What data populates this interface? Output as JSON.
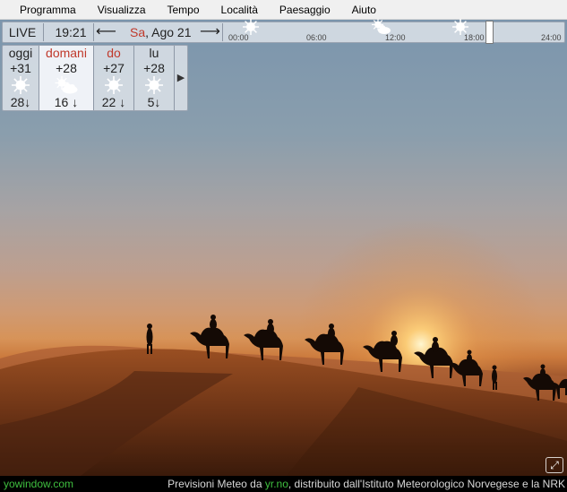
{
  "menu": [
    "Programma",
    "Visualizza",
    "Tempo",
    "Località",
    "Paesaggio",
    "Aiuto"
  ],
  "controls": {
    "live": "LIVE",
    "time": "19:21",
    "day_of_week": "Sa",
    "date": ", Ago 21",
    "prev_icon": "arrow-left-icon",
    "next_icon": "arrow-right-icon"
  },
  "timeline": {
    "labels": [
      "00:00",
      "06:00",
      "12:00",
      "18:00",
      "24:00"
    ],
    "icons": [
      "sun-icon",
      "partly-cloudy-icon",
      "sun-icon"
    ],
    "slider_position": 0.8
  },
  "forecast": [
    {
      "name": "oggi",
      "temp": "+31",
      "icon": "sun-icon",
      "wind": "28",
      "name_color": "#222222",
      "selected": false
    },
    {
      "name": "domani",
      "temp": "+28",
      "icon": "partly-cloudy-icon",
      "wind": "16",
      "name_color": "#c0392b",
      "selected": true
    },
    {
      "name": "do",
      "temp": "+27",
      "icon": "sun-icon",
      "wind": "22",
      "name_color": "#c0392b",
      "selected": false
    },
    {
      "name": "lu",
      "temp": "+28",
      "icon": "sun-icon",
      "wind": "5",
      "name_color": "#222222",
      "selected": false
    }
  ],
  "wind_arrow": "↓",
  "forecast_next": "▶",
  "footer": {
    "left": "yowindow.com",
    "right_prefix": "Previsioni Meteo da ",
    "right_link": "yr.no",
    "right_suffix": ", distribuito dall'Istituto Meteorologico Norvegese e la NRK"
  },
  "colors": {
    "accent_red": "#c0392b",
    "footer_green": "#3fbf3f"
  }
}
